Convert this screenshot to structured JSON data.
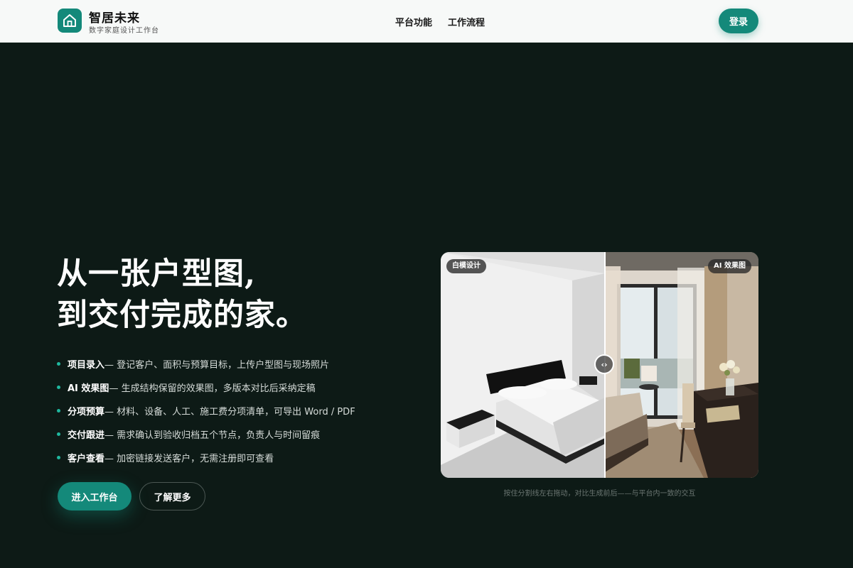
{
  "header": {
    "brand_title": "智居未来",
    "brand_subtitle": "数字家庭设计工作台",
    "nav": [
      "平台功能",
      "工作流程"
    ],
    "login_label": "登录"
  },
  "hero": {
    "headline_line1": "从一张户型图,",
    "headline_line2": "到交付完成的家。",
    "features": [
      {
        "title": "项目录入",
        "desc": " — 登记客户、面积与预算目标，上传户型图与现场照片"
      },
      {
        "title": "AI 效果图",
        "desc": " — 生成结构保留的效果图，多版本对比后采纳定稿"
      },
      {
        "title": "分项预算",
        "desc": " — 材料、设备、人工、施工费分项清单，可导出 Word / PDF"
      },
      {
        "title": "交付跟进",
        "desc": " — 需求确认到验收归档五个节点，负责人与时间留痕"
      },
      {
        "title": "客户查看",
        "desc": " — 加密链接发送客户，无需注册即可查看"
      }
    ],
    "primary_button": "进入工作台",
    "secondary_button": "了解更多"
  },
  "compare": {
    "left_tag": "白模设计",
    "right_tag": "AI 效果图",
    "handle_icon": "‹›",
    "hint": "按住分割线左右拖动，对比生成前后——与平台内一致的交互"
  },
  "colors": {
    "accent": "#14897a",
    "background": "#0d1a16",
    "header_bg": "#f7f9f8"
  }
}
